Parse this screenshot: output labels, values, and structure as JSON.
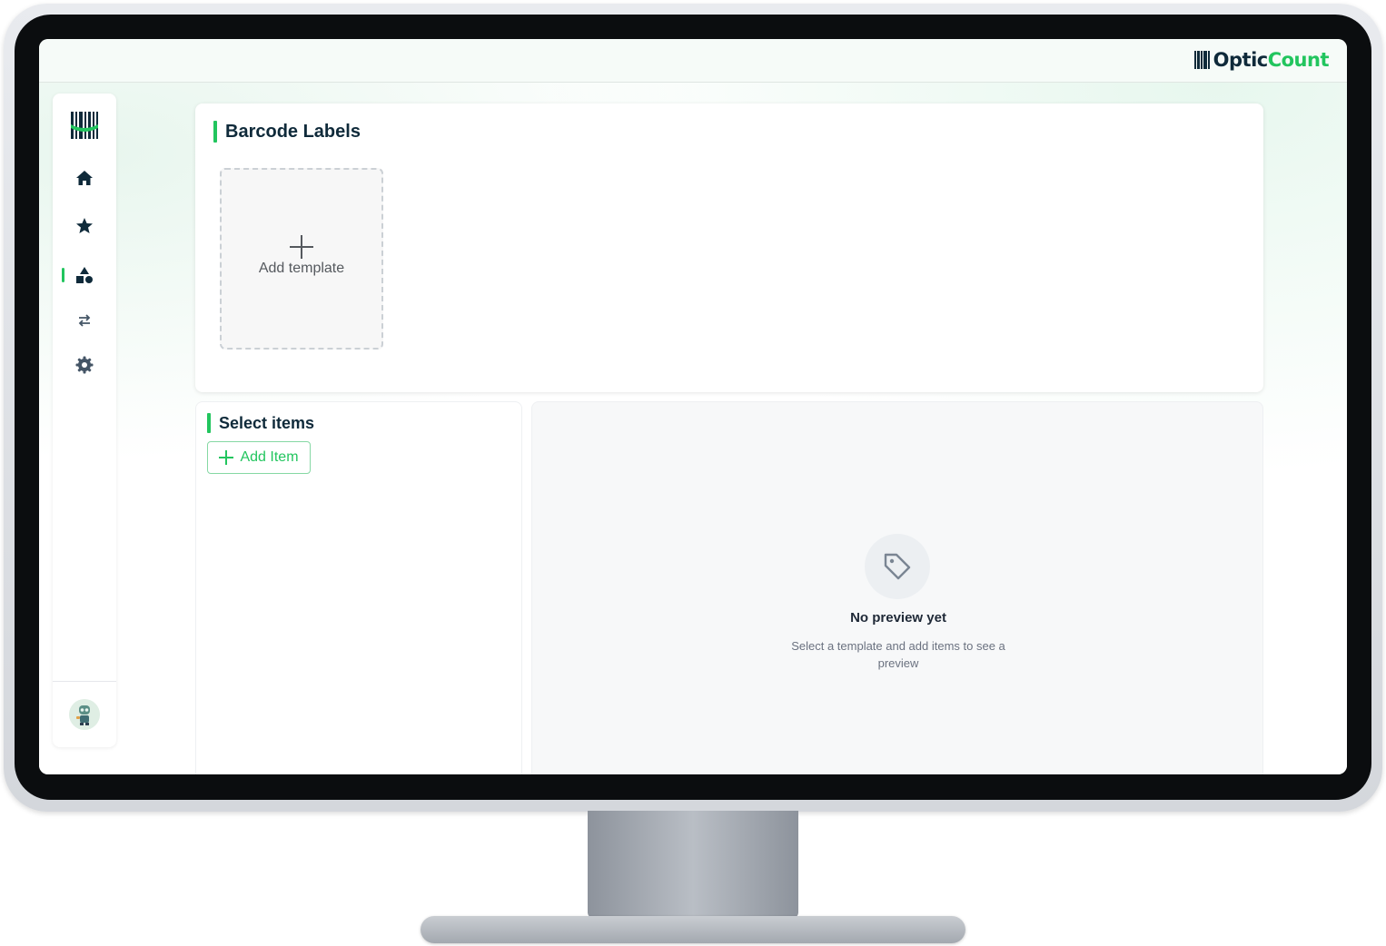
{
  "app": {
    "brand_part1": "Optic",
    "brand_part2": "Count",
    "accent_color": "#22c55e",
    "primary_color": "#0f2a3a"
  },
  "sidebar": {
    "items": [
      {
        "icon": "home-icon",
        "active": false
      },
      {
        "icon": "star-icon",
        "active": false
      },
      {
        "icon": "shapes-icon",
        "active": true
      },
      {
        "icon": "transfer-icon",
        "active": false
      },
      {
        "icon": "gear-icon",
        "active": false
      }
    ],
    "avatar_icon": "robot-avatar-icon"
  },
  "barcode_labels": {
    "title": "Barcode Labels",
    "add_template_label": "Add template"
  },
  "select_items": {
    "title": "Select items",
    "add_item_label": "Add Item"
  },
  "preview": {
    "icon": "tag-icon",
    "empty_title": "No preview yet",
    "empty_description": "Select a template and add items to see a preview"
  }
}
